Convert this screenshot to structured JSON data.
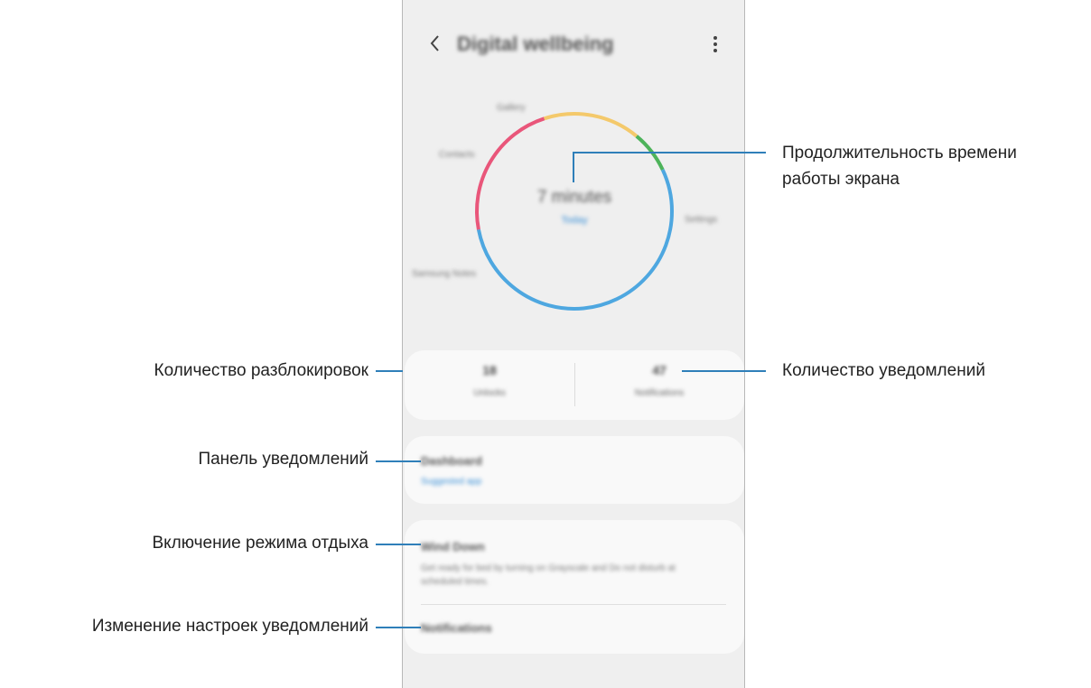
{
  "phone": {
    "title": "Digital wellbeing",
    "ring": {
      "total_time": "7 minutes",
      "today_label": "Today",
      "segments": [
        {
          "app": "Settings",
          "fraction": 0.47,
          "color": "#4ea7e0"
        },
        {
          "app": "Samsung Notes",
          "fraction": 0.23,
          "color": "#e9567a"
        },
        {
          "app": "Contacts",
          "fraction": 0.16,
          "color": "#f4c96b"
        },
        {
          "app": "Gallery",
          "fraction": 0.07,
          "color": "#4db35a"
        }
      ],
      "labels": {
        "gallery": "Gallery",
        "contacts": "Contacts",
        "settings": "Settings",
        "samsung_notes": "Samsung Notes"
      }
    },
    "stats": {
      "unlocks_value": "18",
      "unlocks_label": "Unlocks",
      "notifications_value": "47",
      "notifications_label": "Notifications"
    },
    "dashboard": {
      "title": "Dashboard",
      "subtitle": "Suggested app"
    },
    "wind_down": {
      "title": "Wind Down",
      "description": "Get ready for bed by turning on Grayscale and Do not disturb at scheduled times."
    },
    "notifications": {
      "title": "Notifications"
    }
  },
  "callouts": {
    "screen_time_line1": "Продолжительность времени",
    "screen_time_line2": "работы экрана",
    "unlocks": "Количество разблокировок",
    "notifications_count": "Количество уведомлений",
    "dashboard": "Панель уведомлений",
    "wind_down": "Включение режима отдыха",
    "notification_settings": "Изменение настроек уведомлений"
  },
  "colors": {
    "accent": "#3a8fd6",
    "callout_line": "#2f7fb9"
  }
}
